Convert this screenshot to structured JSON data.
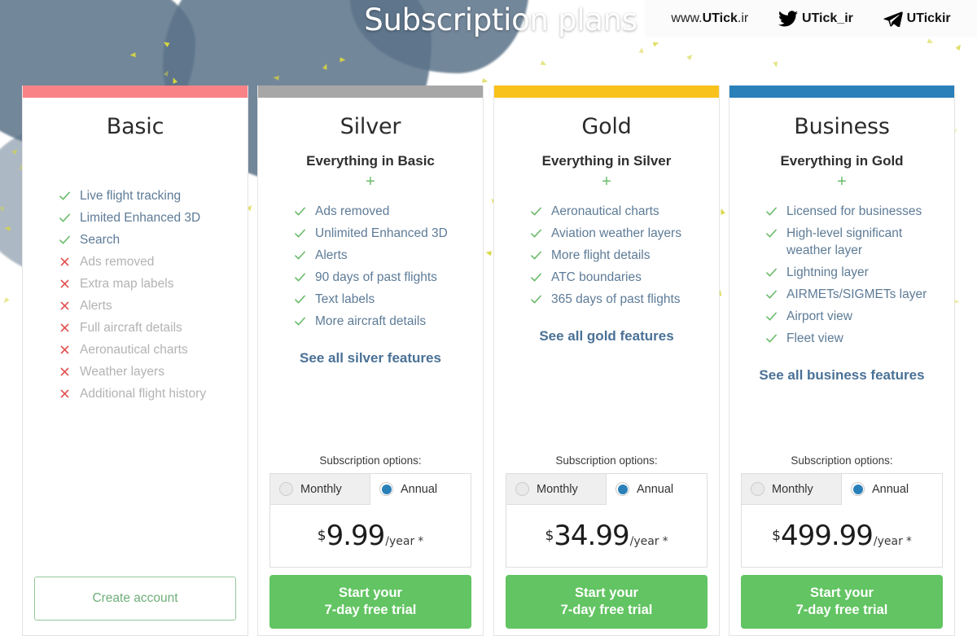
{
  "header": {
    "title": "Subscription plans",
    "social": [
      {
        "icon": "globe-icon",
        "pre": "www.",
        "bold": "UTick",
        "post": ".ir"
      },
      {
        "icon": "twitter-icon",
        "handle": "UTick_ir"
      },
      {
        "icon": "telegram-icon",
        "handle": "UTickir"
      }
    ]
  },
  "colors": {
    "basic": "#f98287",
    "silver": "#a7a7a7",
    "gold": "#f9c21a",
    "business": "#2a80b9",
    "check": "#6abb6a",
    "cross": "#e0514f",
    "cta": "#62c462",
    "link": "#4a7196",
    "radio_on": "#2a80b9"
  },
  "plans": [
    {
      "id": "basic",
      "name": "Basic",
      "accent": "#f98287",
      "subtitle": null,
      "features": [
        {
          "label": "Live flight tracking",
          "included": true
        },
        {
          "label": "Limited Enhanced 3D",
          "included": true
        },
        {
          "label": "Search",
          "included": true
        },
        {
          "label": "Ads removed",
          "included": false
        },
        {
          "label": "Extra map labels",
          "included": false
        },
        {
          "label": "Alerts",
          "included": false
        },
        {
          "label": "Full aircraft details",
          "included": false
        },
        {
          "label": "Aeronautical charts",
          "included": false
        },
        {
          "label": "Weather layers",
          "included": false
        },
        {
          "label": "Additional flight history",
          "included": false
        }
      ],
      "see_all": null,
      "subscription": null,
      "cta": {
        "type": "outline",
        "label": "Create account"
      }
    },
    {
      "id": "silver",
      "name": "Silver",
      "accent": "#a7a7a7",
      "subtitle": "Everything in Basic",
      "features": [
        {
          "label": "Ads removed",
          "included": true
        },
        {
          "label": "Unlimited Enhanced 3D",
          "included": true
        },
        {
          "label": "Alerts",
          "included": true
        },
        {
          "label": "90 days of past flights",
          "included": true
        },
        {
          "label": "Text labels",
          "included": true
        },
        {
          "label": "More aircraft details",
          "included": true
        }
      ],
      "see_all": "See all silver features",
      "subscription": {
        "title": "Subscription options:",
        "options": [
          {
            "label": "Monthly",
            "selected": false
          },
          {
            "label": "Annual",
            "selected": true
          }
        ],
        "currency": "$",
        "amount": "9.99",
        "period": "/year",
        "footnote": "*"
      },
      "cta": {
        "type": "solid",
        "line1": "Start your",
        "line2": "7-day free trial"
      }
    },
    {
      "id": "gold",
      "name": "Gold",
      "accent": "#f9c21a",
      "subtitle": "Everything in Silver",
      "features": [
        {
          "label": "Aeronautical charts",
          "included": true
        },
        {
          "label": "Aviation weather layers",
          "included": true
        },
        {
          "label": "More flight details",
          "included": true
        },
        {
          "label": "ATC boundaries",
          "included": true
        },
        {
          "label": "365 days of past flights",
          "included": true
        }
      ],
      "see_all": "See all gold features",
      "subscription": {
        "title": "Subscription options:",
        "options": [
          {
            "label": "Monthly",
            "selected": false
          },
          {
            "label": "Annual",
            "selected": true
          }
        ],
        "currency": "$",
        "amount": "34.99",
        "period": "/year",
        "footnote": "*"
      },
      "cta": {
        "type": "solid",
        "line1": "Start your",
        "line2": "7-day free trial"
      }
    },
    {
      "id": "business",
      "name": "Business",
      "accent": "#2a80b9",
      "subtitle": "Everything in Gold",
      "features": [
        {
          "label": "Licensed for businesses",
          "included": true
        },
        {
          "label": "High-level significant weather layer",
          "included": true
        },
        {
          "label": "Lightning layer",
          "included": true
        },
        {
          "label": "AIRMETs/SIGMETs layer",
          "included": true
        },
        {
          "label": "Airport view",
          "included": true
        },
        {
          "label": "Fleet view",
          "included": true
        }
      ],
      "see_all": "See all business features",
      "subscription": {
        "title": "Subscription options:",
        "options": [
          {
            "label": "Monthly",
            "selected": false
          },
          {
            "label": "Annual",
            "selected": true
          }
        ],
        "currency": "$",
        "amount": "499.99",
        "period": "/year",
        "footnote": "*"
      },
      "cta": {
        "type": "solid",
        "line1": "Start your",
        "line2": "7-day free trial"
      }
    }
  ]
}
